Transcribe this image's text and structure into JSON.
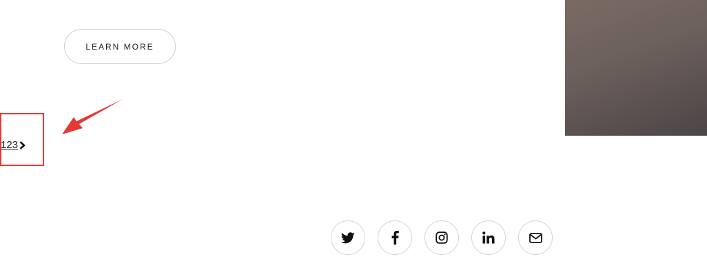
{
  "cta": {
    "learn_more_label": "LEARN MORE"
  },
  "pagination": {
    "pages": [
      "1",
      "2",
      "3"
    ],
    "next_icon": "chevron-right-icon"
  },
  "hero": {
    "image_icon": "photo-image"
  },
  "annotation": {
    "color": "#e53935"
  },
  "social": {
    "items": [
      {
        "name": "twitter",
        "icon": "twitter-icon"
      },
      {
        "name": "facebook",
        "icon": "facebook-icon"
      },
      {
        "name": "instagram",
        "icon": "instagram-icon"
      },
      {
        "name": "linkedin",
        "icon": "linkedin-icon"
      },
      {
        "name": "email",
        "icon": "envelope-icon"
      }
    ]
  }
}
